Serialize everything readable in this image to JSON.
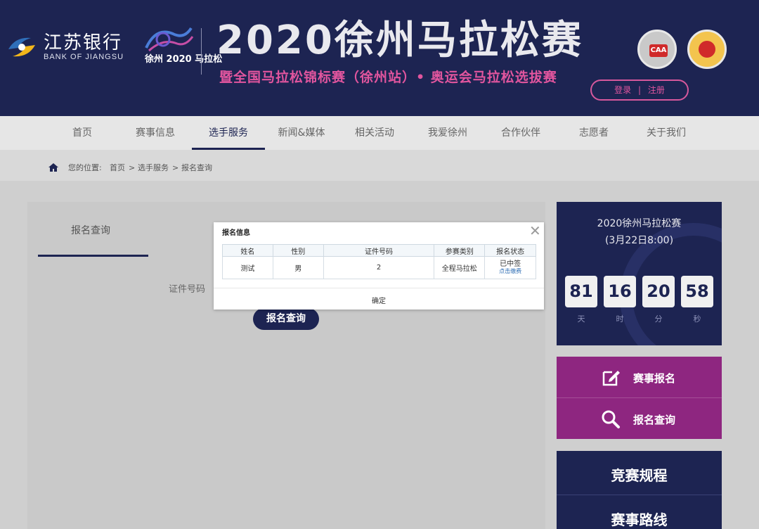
{
  "header": {
    "bank_name_cn": "江苏银行",
    "bank_name_en": "BANK OF JIANGSU",
    "race_logo_text": "徐州 2020 马拉松",
    "title": "2020徐州马拉松赛",
    "subtitle": "暨全国马拉松锦标赛（徐州站）• 奥运会马拉松选拔赛",
    "badge1_text": "CAA",
    "login": "登录",
    "divider": "|",
    "register": "注册"
  },
  "nav": {
    "items": [
      "首页",
      "赛事信息",
      "选手服务",
      "新闻&媒体",
      "相关活动",
      "我爱徐州",
      "合作伙伴",
      "志愿者",
      "关于我们"
    ],
    "active_index": 2
  },
  "breadcrumb": {
    "prefix": "您的位置:",
    "items": [
      "首页",
      "选手服务",
      "报名查询"
    ],
    "separator": ">"
  },
  "main": {
    "tab": "报名查询",
    "id_label": "证件号码",
    "query_button": "报名查询"
  },
  "modal": {
    "title": "报名信息",
    "close": "✕",
    "columns": [
      "姓名",
      "性别",
      "证件号码",
      "参赛类别",
      "报名状态"
    ],
    "row": {
      "name": "测试",
      "gender": "男",
      "id": "2",
      "category": "全程马拉松",
      "status": "已中签",
      "status_link": "点击缴费"
    },
    "ok": "确定"
  },
  "countdown": {
    "title": "2020徐州马拉松赛",
    "date": "(3月22日8:00)",
    "days": "81",
    "hours": "16",
    "minutes": "20",
    "seconds": "58",
    "days_label": "天",
    "hours_label": "时",
    "minutes_label": "分",
    "seconds_label": "秒"
  },
  "side_links": {
    "register": "赛事报名",
    "query": "报名查询",
    "rules": "竞赛规程",
    "route": "赛事路线"
  },
  "colors": {
    "navy": "#1d2452",
    "magenta": "#8e2680",
    "pink": "#e1559e"
  }
}
